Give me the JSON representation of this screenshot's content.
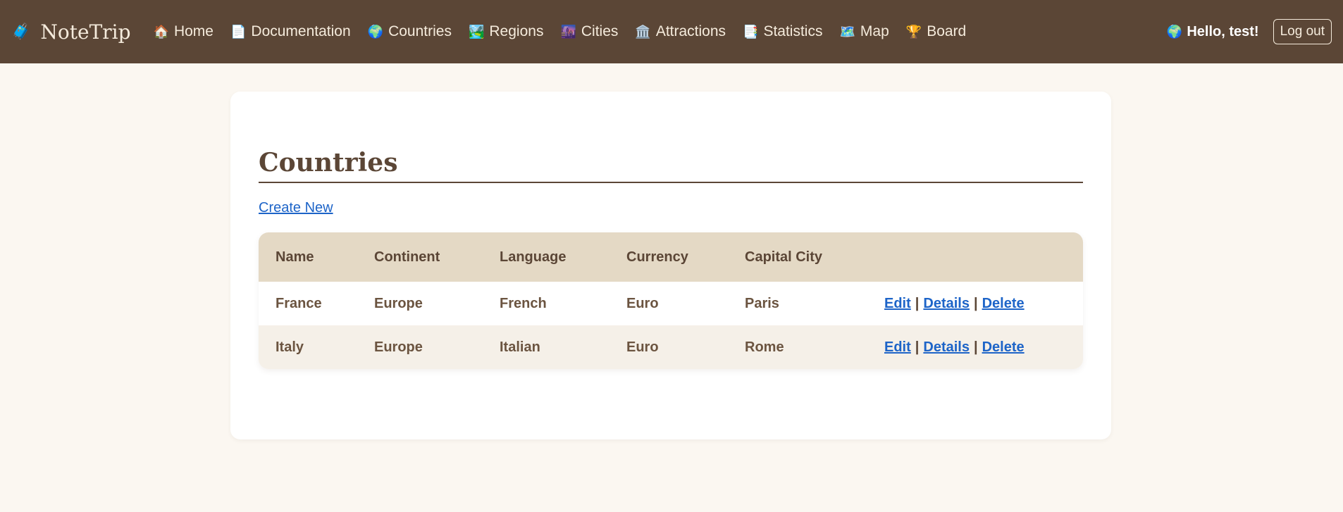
{
  "nav": {
    "brand": {
      "icon": "🧳",
      "label": "NoteTrip"
    },
    "links": [
      {
        "icon": "🏠",
        "label": "Home"
      },
      {
        "icon": "📄",
        "label": "Documentation"
      },
      {
        "icon": "🌍",
        "label": "Countries"
      },
      {
        "icon": "🏞️",
        "label": "Regions"
      },
      {
        "icon": "🌆",
        "label": "Cities"
      },
      {
        "icon": "🏛️",
        "label": "Attractions"
      },
      {
        "icon": "📑",
        "label": "Statistics"
      },
      {
        "icon": "🗺️",
        "label": "Map"
      },
      {
        "icon": "🏆",
        "label": "Board"
      }
    ],
    "greeting": {
      "icon": "🌍",
      "label": "Hello, test!"
    },
    "logout_label": "Log out"
  },
  "page": {
    "title": "Countries",
    "create_label": "Create New"
  },
  "table": {
    "headers": [
      "Name",
      "Continent",
      "Language",
      "Currency",
      "Capital City",
      ""
    ],
    "rows": [
      {
        "name": "France",
        "continent": "Europe",
        "language": "French",
        "currency": "Euro",
        "capital": "Paris"
      },
      {
        "name": "Italy",
        "continent": "Europe",
        "language": "Italian",
        "currency": "Euro",
        "capital": "Rome"
      }
    ],
    "actions": {
      "edit": "Edit",
      "details": "Details",
      "delete": "Delete",
      "separator": "|"
    }
  },
  "colors": {
    "navbar": "#5b4636",
    "background": "#fbf7f1",
    "header_row": "#e4d9c5",
    "link": "#1d64c8"
  }
}
